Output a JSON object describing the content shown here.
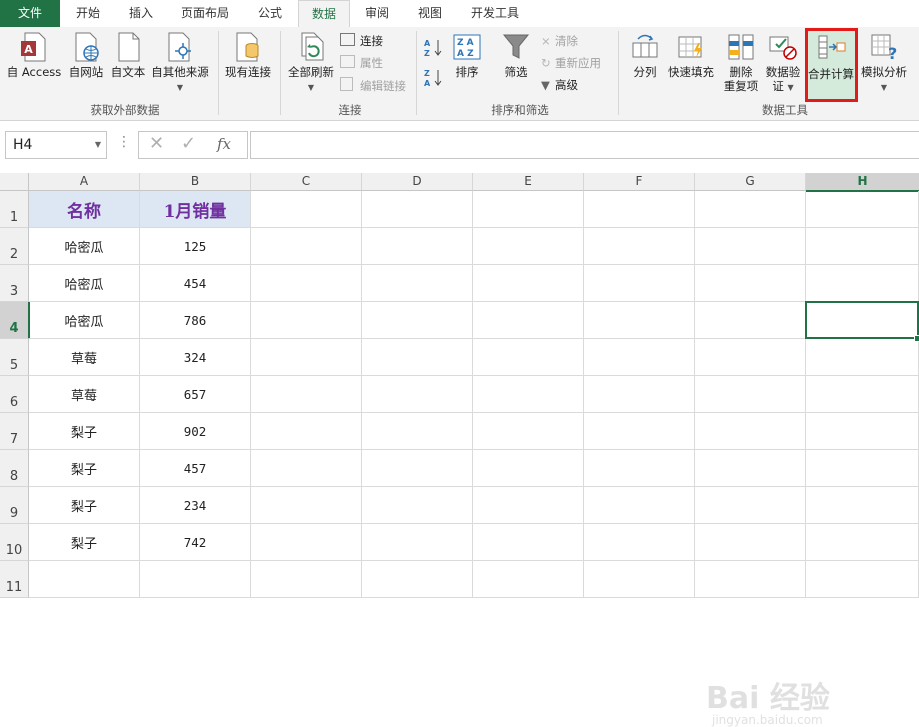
{
  "tabs": [
    "文件",
    "开始",
    "插入",
    "页面布局",
    "公式",
    "数据",
    "审阅",
    "视图",
    "开发工具"
  ],
  "active_tab": "数据",
  "ribbon": {
    "get_external": {
      "buttons": [
        "自 Access",
        "自网站",
        "自文本",
        "自其他来源"
      ],
      "label": "获取外部数据"
    },
    "existing_connections": "现有连接",
    "connections": {
      "refresh_all": "全部刷新",
      "small": [
        "连接",
        "属性",
        "编辑链接"
      ],
      "label": "连接"
    },
    "sort_filter": {
      "sort": "排序",
      "filter": "筛选",
      "small": [
        "清除",
        "重新应用",
        "高级"
      ],
      "label": "排序和筛选"
    },
    "data_tools": {
      "text_to_columns": "分列",
      "flash_fill": "快速填充",
      "remove_dup_1": "删除",
      "remove_dup_2": "重复项",
      "validation_1": "数据验",
      "validation_2": "证",
      "consolidate": "合并计算",
      "what_if": "模拟分析",
      "label": "数据工具"
    }
  },
  "formula_bar": {
    "name_box": "H4",
    "fx": "fx",
    "value": ""
  },
  "columns": [
    "A",
    "B",
    "C",
    "D",
    "E",
    "F",
    "G",
    "H"
  ],
  "selected_column": "H",
  "selected_row": "4",
  "rows": [
    "1",
    "2",
    "3",
    "4",
    "5",
    "6",
    "7",
    "8",
    "9",
    "10",
    "11"
  ],
  "table": {
    "headers": [
      "名称",
      "1月销量"
    ],
    "data": [
      [
        "哈密瓜",
        "125"
      ],
      [
        "哈密瓜",
        "454"
      ],
      [
        "哈密瓜",
        "786"
      ],
      [
        "草莓",
        "324"
      ],
      [
        "草莓",
        "657"
      ],
      [
        "梨子",
        "902"
      ],
      [
        "梨子",
        "457"
      ],
      [
        "梨子",
        "234"
      ],
      [
        "梨子",
        "742"
      ]
    ]
  },
  "watermark": {
    "brand": "Bai 经验",
    "url": "jingyan.baidu.com"
  },
  "colors": {
    "excel_green": "#217346",
    "highlight_red": "#e21a1a",
    "header_fill": "#dde7f3",
    "header_text": "#7030a0"
  }
}
